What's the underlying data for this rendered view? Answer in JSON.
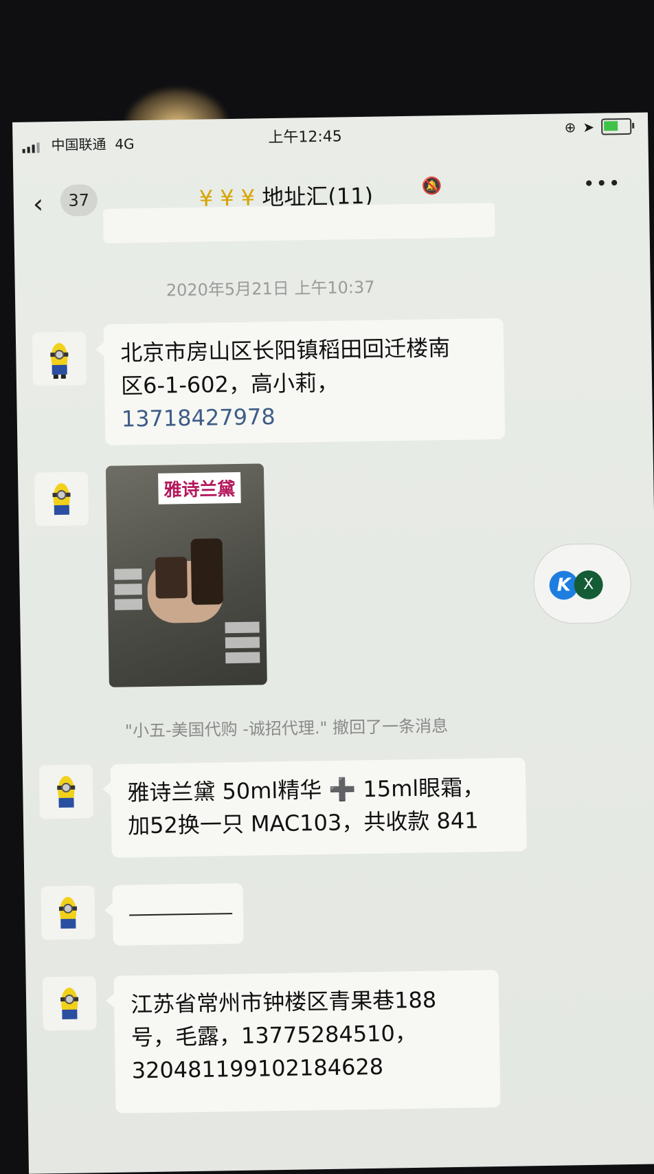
{
  "status_bar": {
    "carrier": "中国联通",
    "network": "4G",
    "time": "上午12:45",
    "battery_level": 0.6
  },
  "header": {
    "back_count": "37",
    "title_prefix": "¥ ¥ ¥ ",
    "title": "地址汇(11)"
  },
  "timestamp": "2020年5月21日 上午10:37",
  "messages": [
    {
      "lines": [
        "北京市房山区长阳镇稻田回迁楼南",
        "区6-1-602，高小莉，"
      ],
      "phone": "13718427978"
    },
    {
      "image_title": "雅诗兰黛"
    },
    {
      "lines": [
        "雅诗兰黛 50ml精华 ➕ 15ml眼霜，",
        "加52换一只 MAC103，共收款 841"
      ]
    },
    {
      "lines": []
    },
    {
      "lines": [
        "江苏省常州市钟楼区青果巷188",
        "号，毛露，13775284510，",
        "320481199102184628"
      ]
    }
  ],
  "recall_notice": "\"小五-美国代购 -诚招代理.\" 撤回了一条消息",
  "floating_widget": {
    "left_label": "K",
    "right_label": "X"
  },
  "colors": {
    "accent_yen": "#d6a400",
    "link": "#3e5c87",
    "battery": "#3fc247"
  }
}
